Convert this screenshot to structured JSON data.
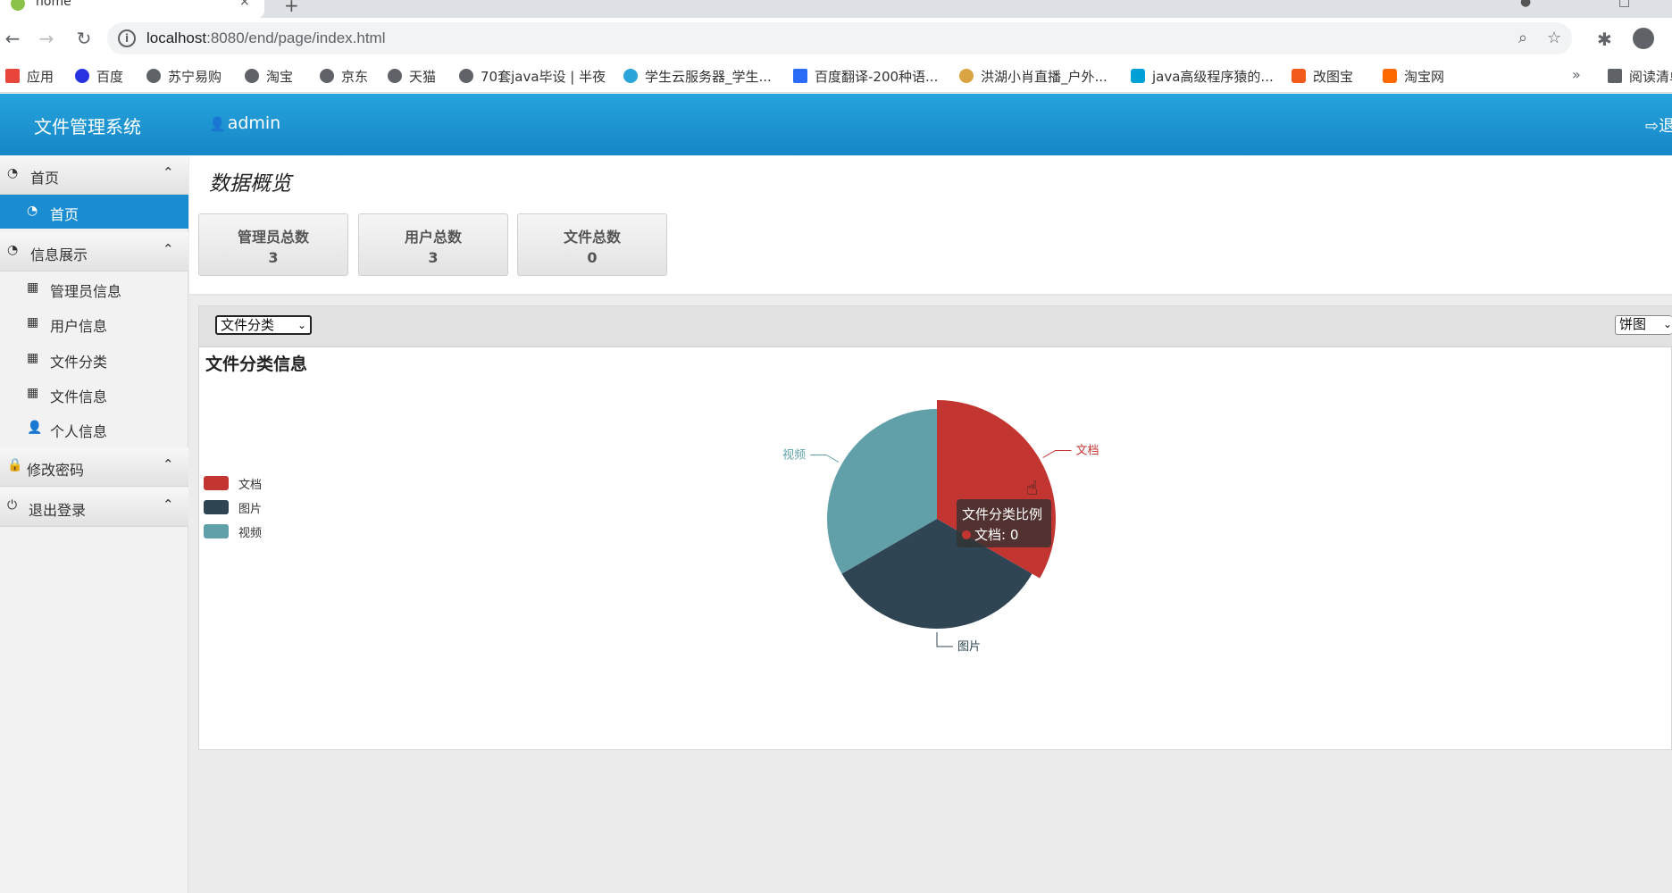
{
  "browser": {
    "tab_title": "home",
    "tab_close": "×",
    "new_tab": "+",
    "url_host": "localhost",
    "url_rest": ":8080/end/page/index.html",
    "icons": {
      "back": "back-arrow-icon",
      "forward": "forward-arrow-icon",
      "reload": "reload-icon",
      "zoom": "zoom-icon",
      "star": "star-icon",
      "extensions": "puzzle-icon",
      "profile": "profile-icon"
    },
    "bookmarks": [
      {
        "label": "应用",
        "icon": "apps-grid-icon"
      },
      {
        "label": "百度",
        "icon": "baidu-paw-icon"
      },
      {
        "label": "苏宁易购",
        "icon": "globe-icon"
      },
      {
        "label": "淘宝",
        "icon": "globe-icon"
      },
      {
        "label": "京东",
        "icon": "globe-icon"
      },
      {
        "label": "天猫",
        "icon": "globe-icon"
      },
      {
        "label": "70套java毕设 | 半夜",
        "icon": "globe-icon"
      },
      {
        "label": "学生云服务器_学生...",
        "icon": "cloud-icon"
      },
      {
        "label": "百度翻译-200种语...",
        "icon": "translate-icon"
      },
      {
        "label": "洪湖小肖直播_户外...",
        "icon": "bird-icon"
      },
      {
        "label": "java高级程序猿的...",
        "icon": "bilibili-icon"
      },
      {
        "label": "改图宝",
        "icon": "orange-square-icon"
      },
      {
        "label": "淘宝网",
        "icon": "taobao-icon"
      }
    ],
    "bookmarks_more": "»",
    "reading_list": "阅读清单"
  },
  "header": {
    "title": "文件管理系统",
    "user": "admin",
    "logout": "退出"
  },
  "sidebar": {
    "groups": [
      {
        "label": "首页",
        "items": [
          {
            "label": "首页",
            "active": true
          }
        ]
      },
      {
        "label": "信息展示",
        "items": [
          {
            "label": "管理员信息"
          },
          {
            "label": "用户信息"
          },
          {
            "label": "文件分类"
          },
          {
            "label": "文件信息"
          },
          {
            "label": "个人信息"
          }
        ]
      },
      {
        "label": "修改密码",
        "items": []
      },
      {
        "label": "退出登录",
        "items": []
      }
    ]
  },
  "overview": {
    "title": "数据概览",
    "stats": [
      {
        "label": "管理员总数",
        "value": "3"
      },
      {
        "label": "用户总数",
        "value": "3"
      },
      {
        "label": "文件总数",
        "value": "0"
      }
    ]
  },
  "chart_panel": {
    "category_select": "文件分类",
    "type_select": "饼图",
    "heading": "文件分类信息",
    "tooltip": {
      "title": "文件分类比例",
      "entry": "文档: 0"
    }
  },
  "chart_data": {
    "type": "pie",
    "title": "文件分类信息",
    "categories": [
      "文档",
      "图片",
      "视频"
    ],
    "values": [
      0,
      0,
      0
    ],
    "colors": [
      "#c23531",
      "#2f4554",
      "#61a0a8"
    ],
    "legend_position": "left"
  }
}
